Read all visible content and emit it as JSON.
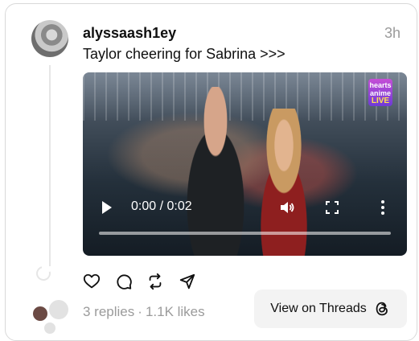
{
  "post": {
    "username": "alyssaash1ey",
    "timestamp": "3h",
    "text": "Taylor cheering for Sabrina >>>"
  },
  "video": {
    "time_display": "0:00 / 0:02",
    "progress": 0.0,
    "overlay_logo_lines": [
      "hearts",
      "anime",
      "LIVE"
    ],
    "controls": [
      "play-icon",
      "volume-icon",
      "fullscreen-icon",
      "more-icon"
    ]
  },
  "actions": [
    "like-icon",
    "comment-icon",
    "repost-icon",
    "share-icon"
  ],
  "stats": {
    "replies": "3 replies",
    "separator": "·",
    "likes": "1.1K likes"
  },
  "view_button": {
    "label": "View on Threads",
    "icon": "threads-icon"
  }
}
